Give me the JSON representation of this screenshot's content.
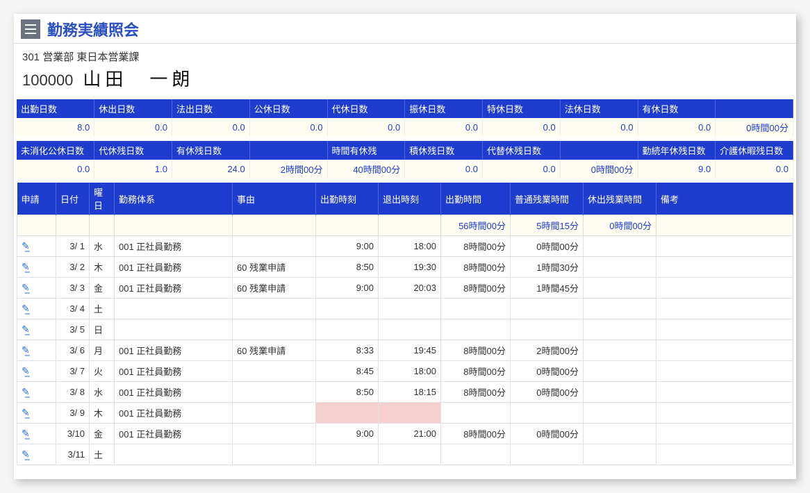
{
  "header": {
    "title": "勤務実績照会",
    "dept": "301  営業部 東日本営業課",
    "emp_id": "100000",
    "emp_name": "山田　一朗"
  },
  "summary1": {
    "headers": [
      "出勤日数",
      "休出日数",
      "法出日数",
      "公休日数",
      "代休日数",
      "振休日数",
      "特休日数",
      "法休日数",
      "有休日数",
      ""
    ],
    "values": [
      "8.0",
      "0.0",
      "0.0",
      "0.0",
      "0.0",
      "0.0",
      "0.0",
      "0.0",
      "0.0",
      "0時間00分"
    ]
  },
  "summary2": {
    "headers": [
      "未消化公休日数",
      "代休残日数",
      "有休残日数",
      "",
      "時間有休残",
      "積休残日数",
      "代替休残日数",
      "",
      "勤続年休残日数",
      "介護休暇残日数"
    ],
    "values": [
      "0.0",
      "1.0",
      "24.0",
      "2時間00分",
      "40時間00分",
      "0.0",
      "0.0",
      "0時間00分",
      "9.0",
      "0.0"
    ]
  },
  "detail": {
    "headers": [
      "申請",
      "日付",
      "曜日",
      "勤務体系",
      "事由",
      "出勤時刻",
      "退出時刻",
      "出勤時間",
      "普通残業時間",
      "休出残業時間",
      "備考"
    ],
    "totals": {
      "work": "56時間00分",
      "ot": "5時間15分",
      "hot": "0時間00分"
    },
    "rows": [
      {
        "date": "3/ 1",
        "dow": "水",
        "dowc": "",
        "work": "001 正社員勤務",
        "reason": "",
        "in": "9:00",
        "out": "18:00",
        "wh": "8時間00分",
        "ot": "0時間00分",
        "hot": "",
        "pink": false
      },
      {
        "date": "3/ 2",
        "dow": "木",
        "dowc": "",
        "work": "001 正社員勤務",
        "reason": "60 残業申請",
        "in": "8:50",
        "out": "19:30",
        "wh": "8時間00分",
        "ot": "1時間30分",
        "hot": "",
        "pink": false
      },
      {
        "date": "3/ 3",
        "dow": "金",
        "dowc": "",
        "work": "001 正社員勤務",
        "reason": "60 残業申請",
        "in": "9:00",
        "out": "20:03",
        "wh": "8時間00分",
        "ot": "1時間45分",
        "hot": "",
        "pink": false
      },
      {
        "date": "3/ 4",
        "dow": "土",
        "dowc": "sat",
        "work": "",
        "reason": "",
        "in": "",
        "out": "",
        "wh": "",
        "ot": "",
        "hot": "",
        "pink": false
      },
      {
        "date": "3/ 5",
        "dow": "日",
        "dowc": "sun",
        "work": "",
        "reason": "",
        "in": "",
        "out": "",
        "wh": "",
        "ot": "",
        "hot": "",
        "pink": false
      },
      {
        "date": "3/ 6",
        "dow": "月",
        "dowc": "",
        "work": "001 正社員勤務",
        "reason": "60 残業申請",
        "in": "8:33",
        "out": "19:45",
        "wh": "8時間00分",
        "ot": "2時間00分",
        "hot": "",
        "pink": false
      },
      {
        "date": "3/ 7",
        "dow": "火",
        "dowc": "",
        "work": "001 正社員勤務",
        "reason": "",
        "in": "8:45",
        "out": "18:00",
        "wh": "8時間00分",
        "ot": "0時間00分",
        "hot": "",
        "pink": false
      },
      {
        "date": "3/ 8",
        "dow": "水",
        "dowc": "",
        "work": "001 正社員勤務",
        "reason": "",
        "in": "8:50",
        "out": "18:15",
        "wh": "8時間00分",
        "ot": "0時間00分",
        "hot": "",
        "pink": false
      },
      {
        "date": "3/ 9",
        "dow": "木",
        "dowc": "",
        "work": "001 正社員勤務",
        "reason": "",
        "in": "",
        "out": "",
        "wh": "",
        "ot": "",
        "hot": "",
        "pink": true
      },
      {
        "date": "3/10",
        "dow": "金",
        "dowc": "",
        "work": "001 正社員勤務",
        "reason": "",
        "in": "9:00",
        "out": "21:00",
        "wh": "8時間00分",
        "ot": "0時間00分",
        "hot": "",
        "pink": false
      },
      {
        "date": "3/11",
        "dow": "土",
        "dowc": "sat",
        "work": "",
        "reason": "",
        "in": "",
        "out": "",
        "wh": "",
        "ot": "",
        "hot": "",
        "pink": false
      }
    ]
  }
}
